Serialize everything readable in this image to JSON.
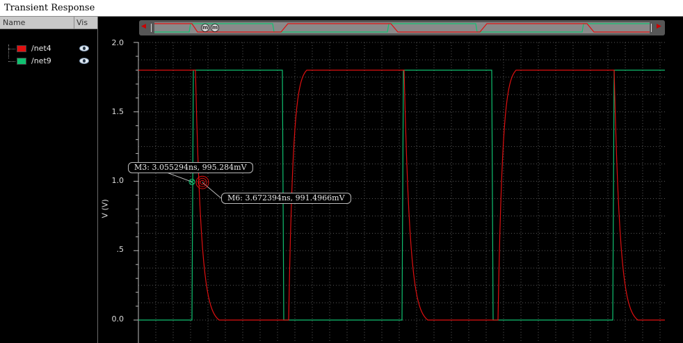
{
  "window": {
    "title": "Transient Response"
  },
  "trace_panel": {
    "col_name": "Name",
    "col_vis": "Vis",
    "traces": [
      {
        "label": "/net4",
        "color": "#e01010",
        "visible": true,
        "icon": "eye-icon"
      },
      {
        "label": "/net9",
        "color": "#10c070",
        "visible": true,
        "icon": "eye-icon"
      }
    ]
  },
  "overview": {
    "markers": [
      "m",
      "m"
    ]
  },
  "axes": {
    "ylabel": "V (V)",
    "yticks": [
      "2.0",
      "1.5",
      "1.0",
      ".5",
      "0.0"
    ]
  },
  "markers": [
    {
      "label": "M3: 3.055294ns, 995.284mV",
      "x_ns": 3.055294,
      "y_mV": 995.284
    },
    {
      "label": "M6: 3.672394ns, 991.4966mV",
      "x_ns": 3.672394,
      "y_mV": 991.4966
    }
  ],
  "chart_data": {
    "type": "line",
    "title": "Transient Response",
    "ylabel": "V (V)",
    "ylim": [
      0,
      2.0
    ],
    "grid": true,
    "series": [
      {
        "name": "/net4",
        "color": "#e01010",
        "low": 0.0,
        "high": 1.8
      },
      {
        "name": "/net9",
        "color": "#10c070",
        "low": 0.0,
        "high": 1.8
      }
    ]
  }
}
